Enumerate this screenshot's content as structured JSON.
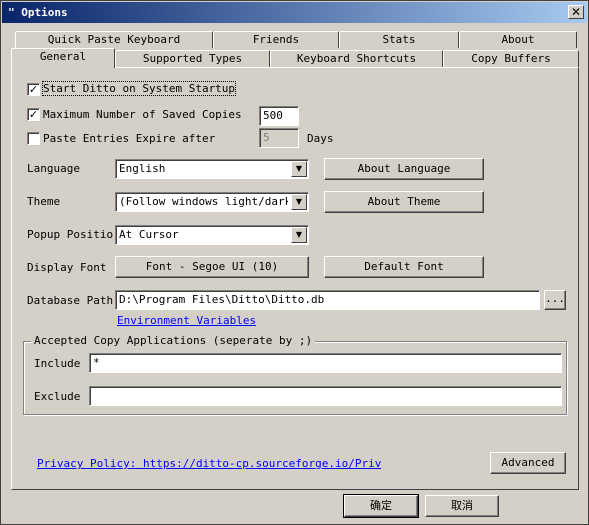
{
  "window": {
    "title": "Options",
    "close_glyph": "✕"
  },
  "tabs": {
    "row1": [
      "Quick Paste Keyboard",
      "Friends",
      "Stats",
      "About"
    ],
    "row2": [
      "General",
      "Supported Types",
      "Keyboard Shortcuts",
      "Copy Buffers"
    ],
    "active": "General"
  },
  "general": {
    "start_on_startup": {
      "label": "Start Ditto on System Startup",
      "checked": true
    },
    "max_saved": {
      "label": "Maximum Number of Saved Copies",
      "checked": true,
      "value": "500"
    },
    "expire": {
      "label": "Paste Entries Expire after",
      "checked": false,
      "value": "5",
      "unit": "Days"
    },
    "language": {
      "label": "Language",
      "value": "English",
      "button": "About Language"
    },
    "theme": {
      "label": "Theme",
      "value": "(Follow windows light/dark th",
      "button": "About Theme"
    },
    "popup_position": {
      "label": "Popup Positio",
      "value": "At Cursor"
    },
    "display_font": {
      "label": "Display Font",
      "font_button": "Font - Segoe UI (10)",
      "default_button": "Default Font"
    },
    "database_path": {
      "label": "Database Path",
      "value": "D:\\Program Files\\Ditto\\Ditto.db",
      "browse": "...",
      "env_link": "Environment Variables"
    },
    "accepted_apps": {
      "title": "Accepted Copy Applications (seperate by ;)",
      "include_label": "Include",
      "include_value": "*",
      "exclude_label": "Exclude",
      "exclude_value": ""
    },
    "privacy_link": "Privacy Policy: https://ditto-cp.sourceforge.io/PrivacyPo",
    "advanced_button": "Advanced"
  },
  "footer": {
    "ok": "确定",
    "cancel": "取消"
  },
  "icons": {
    "check": "✓",
    "dropdown": "▼",
    "title_icon": "\""
  }
}
